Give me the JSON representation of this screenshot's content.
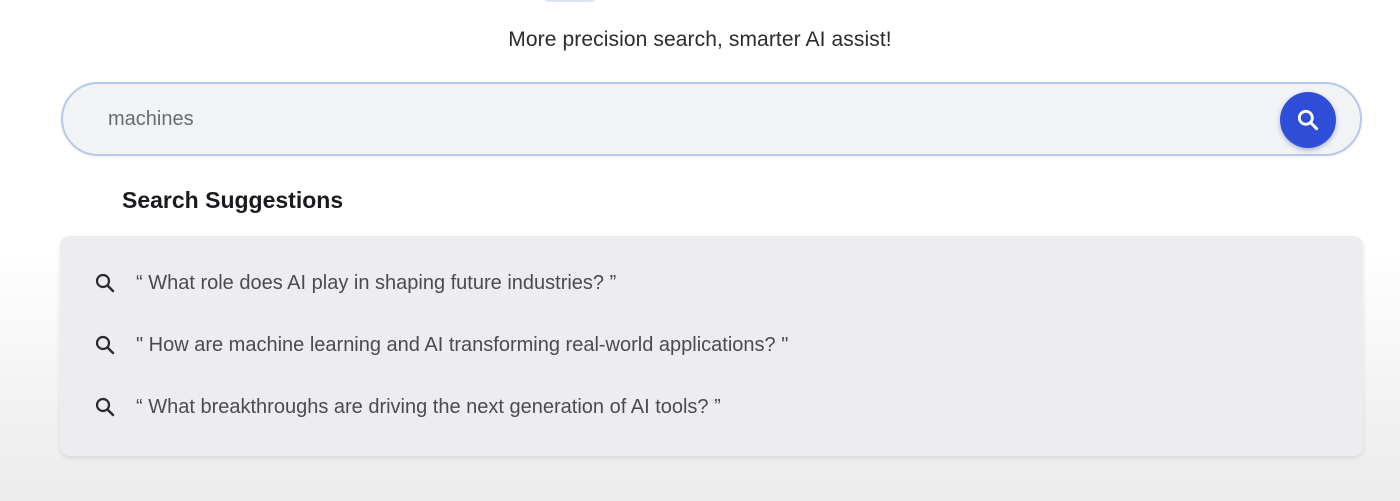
{
  "header": {
    "tagline": "More precision search, smarter AI assist!"
  },
  "search": {
    "value": "machines",
    "button_icon": "search-icon",
    "accent_color": "#2f4ed8"
  },
  "suggestions": {
    "title": "Search Suggestions",
    "items": [
      {
        "icon": "search-icon",
        "text": "“ What role does AI play in shaping future industries? ”"
      },
      {
        "icon": "search-icon",
        "text": "\" How are machine learning and AI transforming real-world applications? \""
      },
      {
        "icon": "search-icon",
        "text": "“ What breakthroughs are driving the next generation of AI tools? ”"
      }
    ]
  }
}
